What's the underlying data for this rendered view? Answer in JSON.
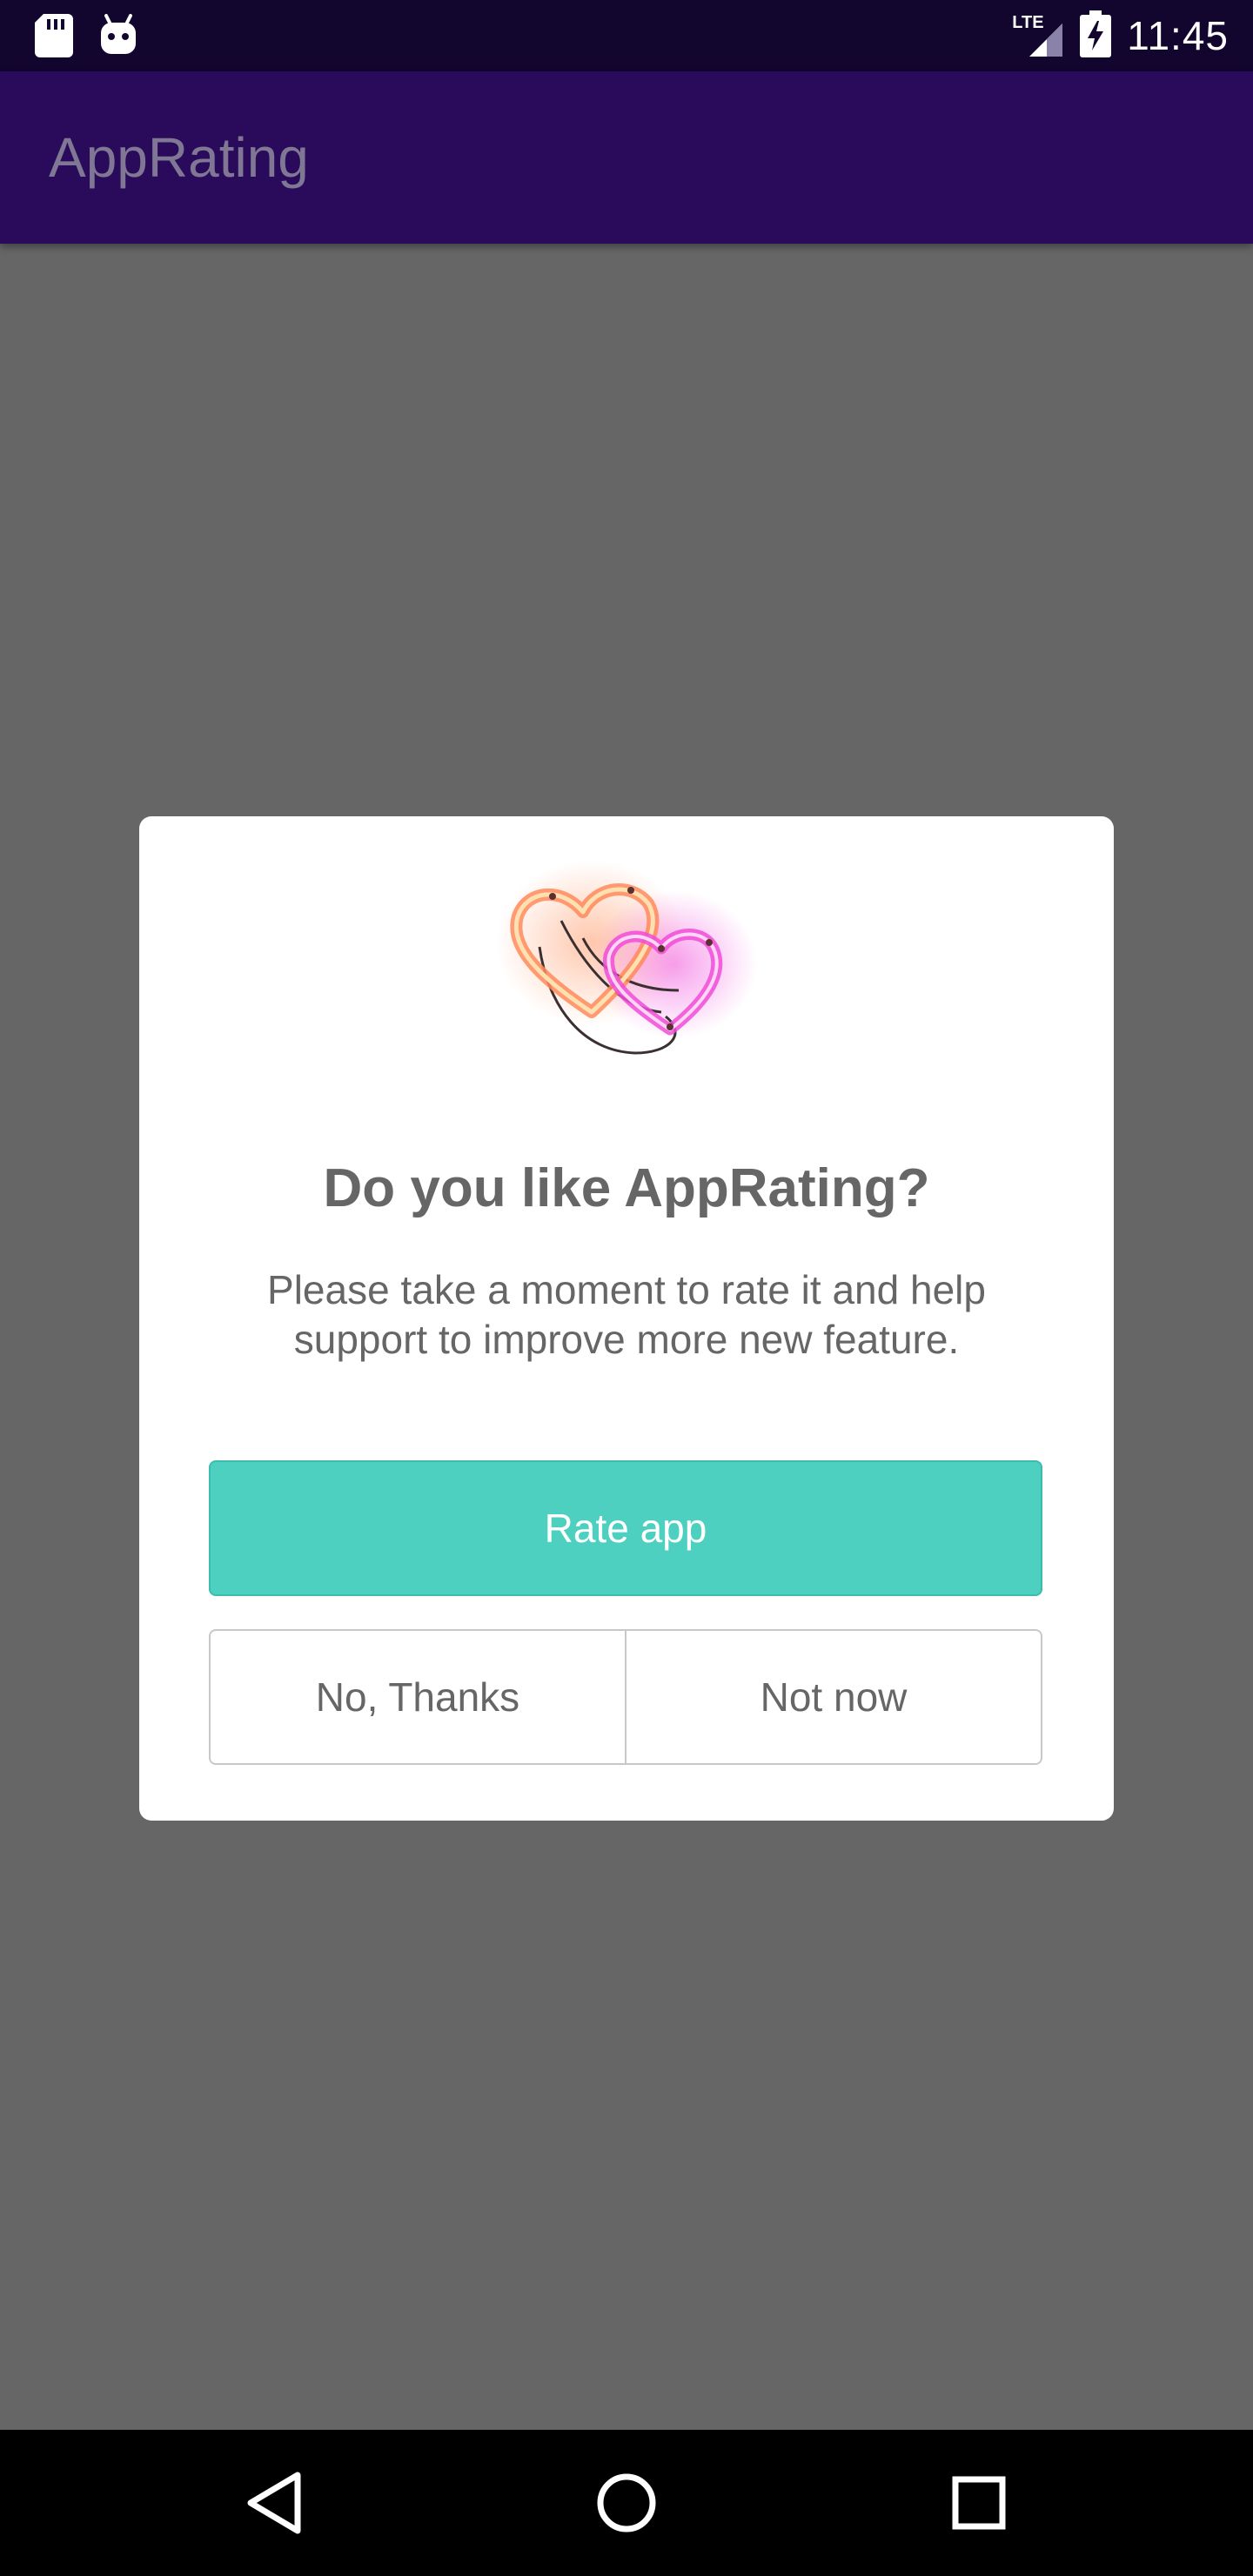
{
  "status_bar": {
    "time": "11:45",
    "network_label": "LTE",
    "icons": [
      "sd-card-icon",
      "android-icon",
      "signal-icon",
      "battery-charging-icon"
    ]
  },
  "app_bar": {
    "title": "AppRating"
  },
  "dialog": {
    "image": "neon-hearts-icon",
    "title": "Do you like AppRating?",
    "message_line1": "Please take a moment to rate it and help",
    "message_line2": "support to improve more new feature.",
    "rate_button": "Rate app",
    "no_thanks_button": "No, Thanks",
    "not_now_button": "Not now"
  },
  "nav_bar": {
    "icons": [
      "back-icon",
      "home-icon",
      "recents-icon"
    ]
  },
  "colors": {
    "status_bar": "#12052e",
    "app_bar": "#2a0a5a",
    "scrim": "#666666",
    "accent": "#4dd0c0"
  }
}
